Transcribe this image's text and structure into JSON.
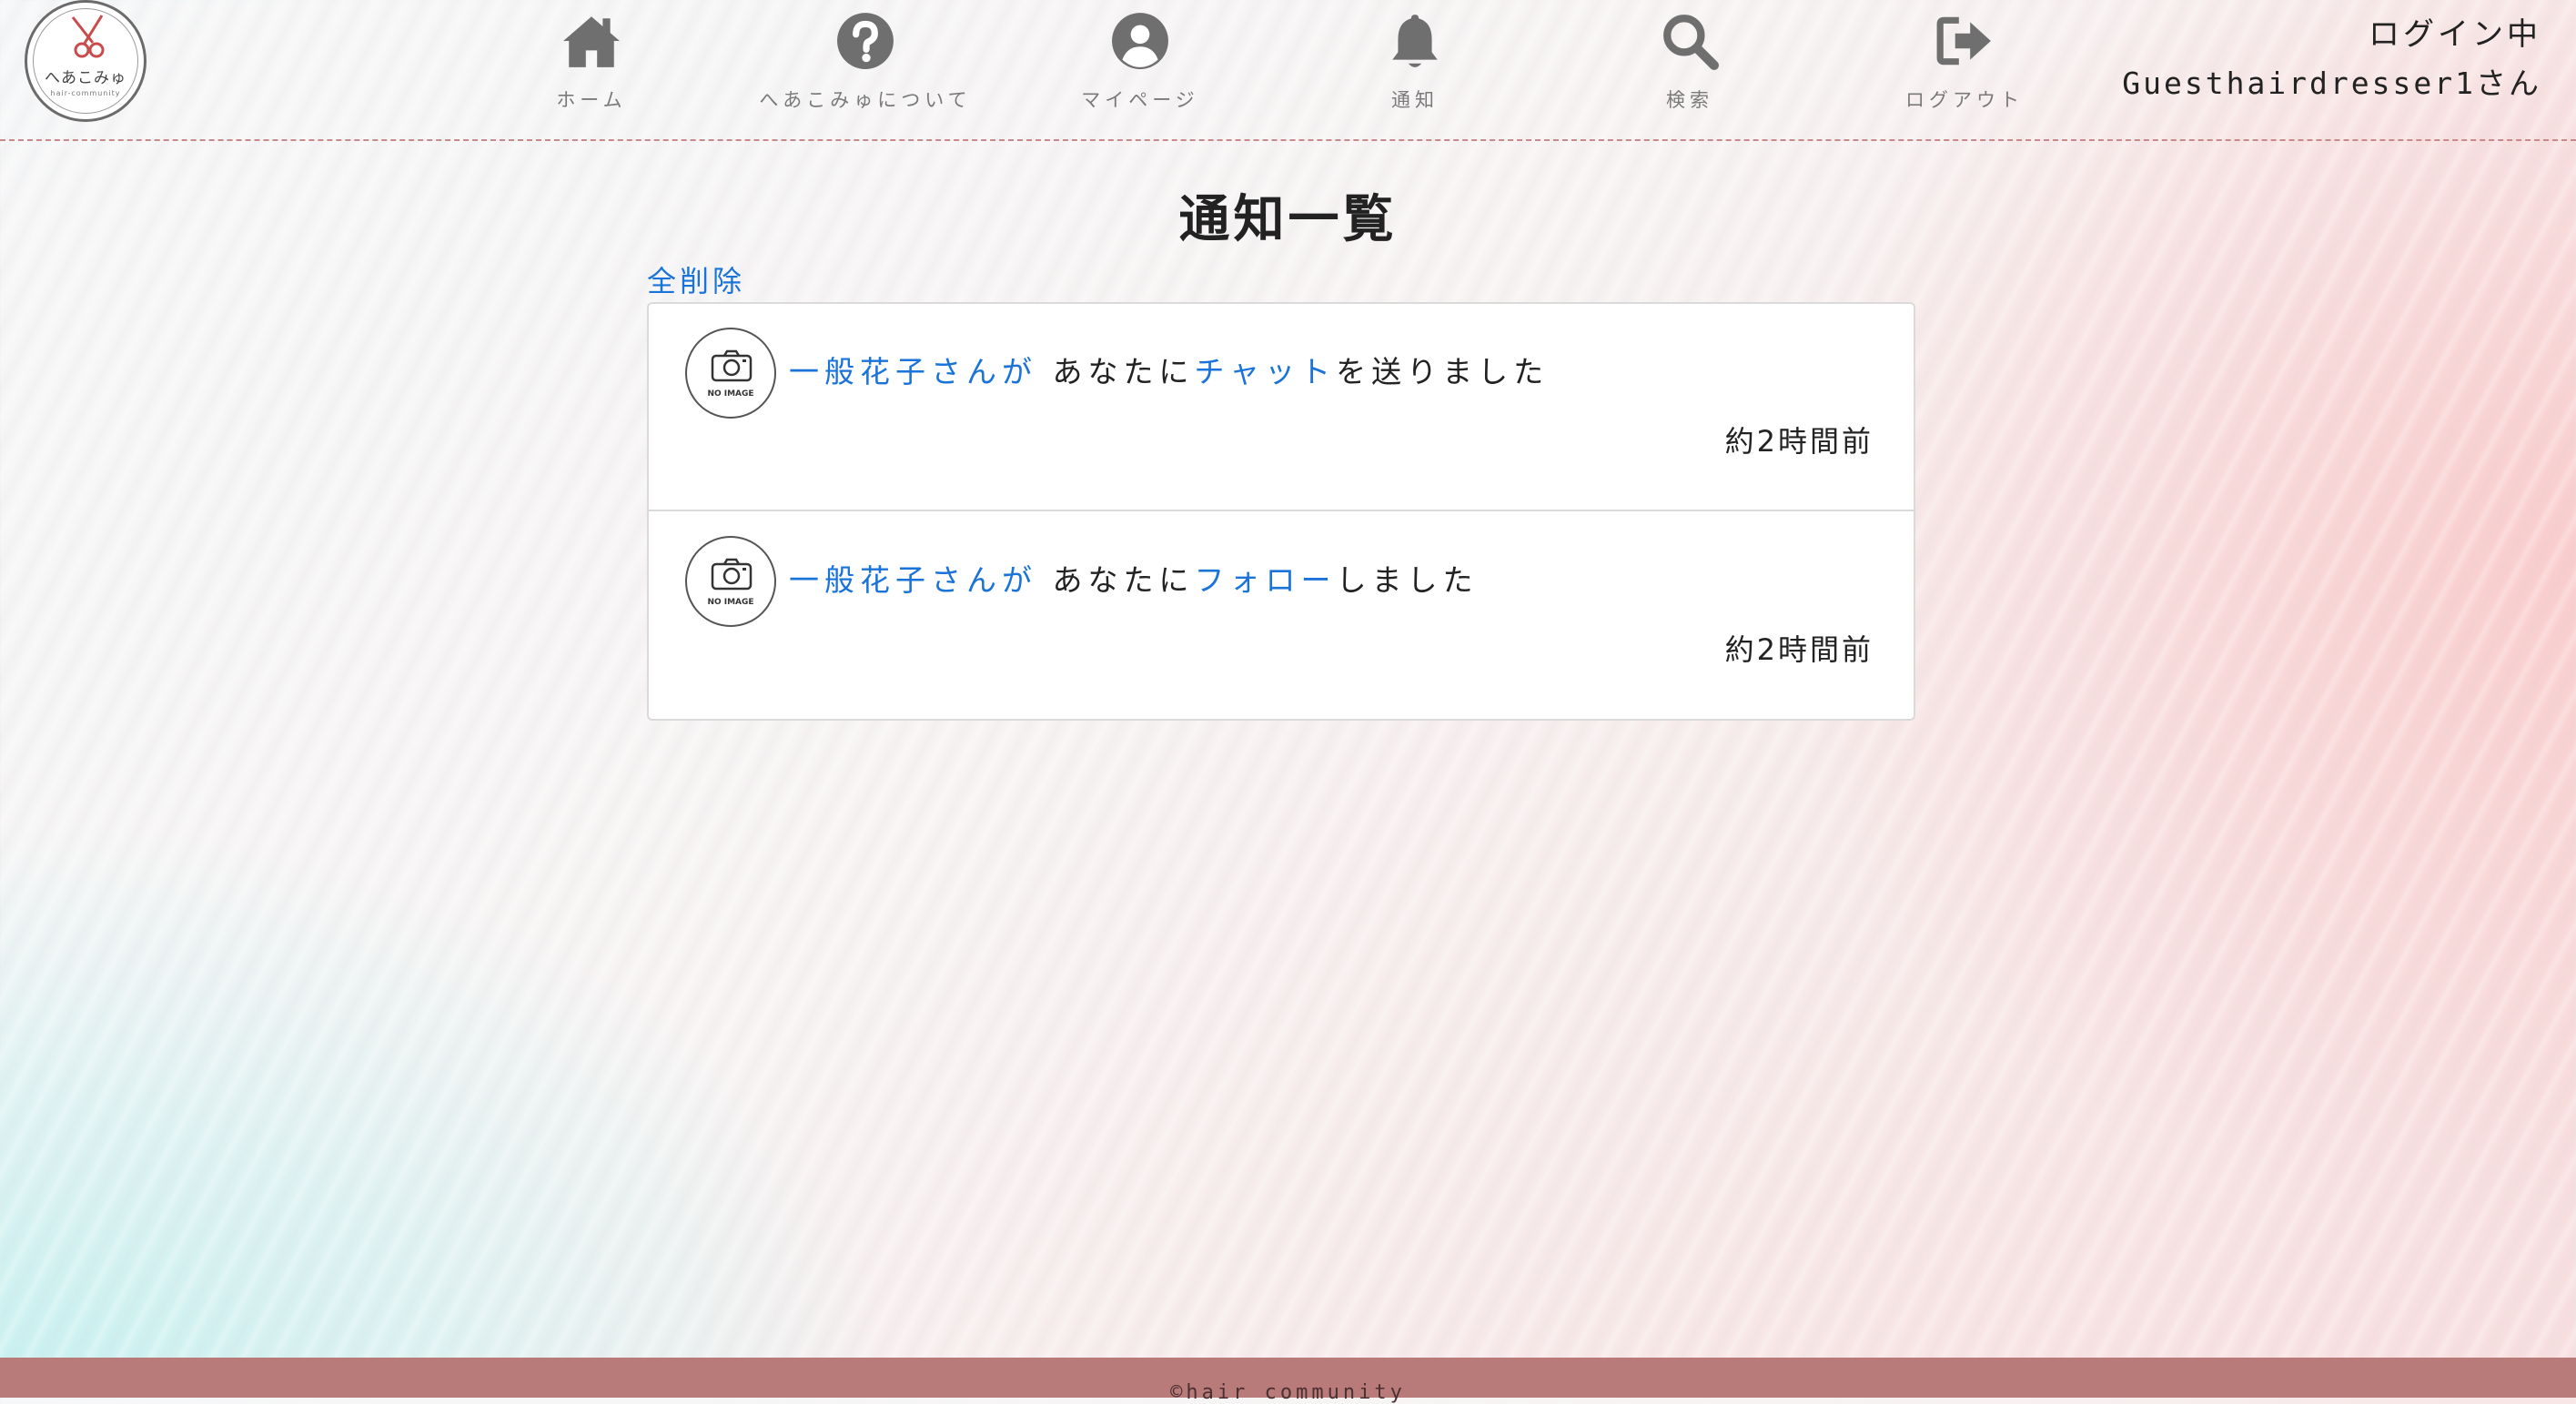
{
  "brand": {
    "logo_text": "へあこみゅ",
    "logo_sub": "hair-community"
  },
  "nav": [
    {
      "label": "ホーム",
      "icon": "home-icon"
    },
    {
      "label": "へあこみゅについて",
      "icon": "question-circle-icon"
    },
    {
      "label": "マイページ",
      "icon": "user-circle-icon"
    },
    {
      "label": "通知",
      "icon": "bell-icon"
    },
    {
      "label": "検索",
      "icon": "search-icon"
    },
    {
      "label": "ログアウト",
      "icon": "sign-out-icon"
    }
  ],
  "login": {
    "status": "ログイン中",
    "user": "Guesthairdresser1さん"
  },
  "page_title": "通知一覧",
  "delete_all_label": "全削除",
  "notifications": [
    {
      "avatar_text": "NO IMAGE",
      "sender": "一般花子さんが",
      "middle": " あなたに",
      "action": "チャット",
      "suffix": "を送りました",
      "time": "約2時間前"
    },
    {
      "avatar_text": "NO IMAGE",
      "sender": "一般花子さんが",
      "middle": " あなたに",
      "action": "フォロー",
      "suffix": "しました",
      "time": "約2時間前"
    }
  ],
  "footer": {
    "copyright": "©hair community"
  },
  "colors": {
    "link": "#1a73d9",
    "nav_icon": "#6f6f6f",
    "footer_bg": "#b97a7a",
    "header_border": "#c9898a"
  }
}
